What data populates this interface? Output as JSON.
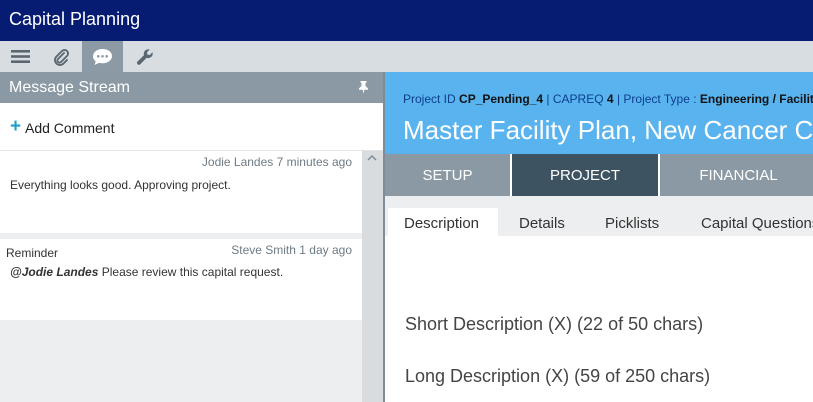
{
  "app": {
    "title": "Capital Planning"
  },
  "toolbar": {
    "items": [
      {
        "name": "menu-icon",
        "active": false
      },
      {
        "name": "paperclip-icon",
        "active": false
      },
      {
        "name": "chat-icon",
        "active": true
      },
      {
        "name": "wrench-icon",
        "active": false
      }
    ]
  },
  "message_stream": {
    "title": "Message Stream",
    "pin_icon": "pin-icon",
    "add_comment_label": "Add Comment",
    "add_comment_icon": "+",
    "messages": [
      {
        "author": "Jodie Landes",
        "time": "7 minutes ago",
        "meta": "Jodie Landes 7 minutes ago",
        "tag": "",
        "body": "Everything looks good. Approving project."
      },
      {
        "author": "Steve Smith",
        "time": "1 day ago",
        "meta": "Steve Smith 1 day ago",
        "tag": "Reminder",
        "mention": "@Jodie Landes",
        "body": " Please review this capital request."
      }
    ]
  },
  "project": {
    "id_label": "Project ID",
    "id_value": "CP_Pending_4",
    "capreq_label": "CAPREQ",
    "capreq_value": "4",
    "type_label": "Project Type :",
    "type_value": "Engineering / Facilities",
    "separator": "|",
    "title": "Master Facility Plan, New Cancer Center"
  },
  "tabs": [
    "SETUP",
    "PROJECT",
    "FINANCIAL"
  ],
  "active_tab": "PROJECT",
  "subtabs": [
    "Description",
    "Details",
    "Picklists",
    "Capital Questions"
  ],
  "active_subtab": "Description",
  "fields": {
    "short_description": "Short Description (X) (22 of 50 chars)",
    "long_description": "Long Description (X) (59 of 250 chars)"
  },
  "colors": {
    "titlebar": "#051c72",
    "project_header": "#58b3ef",
    "tab_bar": "#8a99a4",
    "active_tab": "#3e5361",
    "accent": "#1aa0c8"
  }
}
